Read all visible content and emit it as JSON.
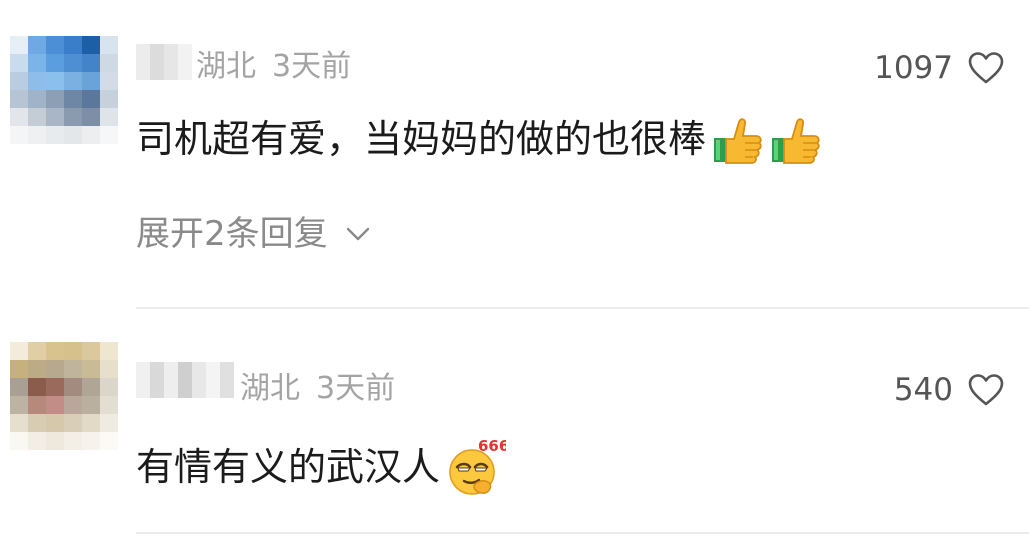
{
  "comments": [
    {
      "location": "湖北",
      "time": "3天前",
      "likes": "1097",
      "text": "司机超有爱，当妈妈的做的也很棒",
      "emojis": [
        "thumbs-up-icon",
        "thumbs-up-icon"
      ],
      "reply_toggle": "展开2条回复",
      "avatar_colors": [
        "#e6eef6",
        "#6fa9e3",
        "#4c8fd7",
        "#3a7dc9",
        "#1d5fa7",
        "#d7e3ef",
        "#c9dcee",
        "#7bb4e8",
        "#5b9ee0",
        "#4e8fd4",
        "#4483c8",
        "#cfd9e4",
        "#b9cde2",
        "#8fbde9",
        "#8cc0ec",
        "#7ab0e2",
        "#6aa3d8",
        "#d3dce6",
        "#b6c4d3",
        "#9fb3c9",
        "#8d9fb5",
        "#6e87a4",
        "#5b789c",
        "#c7d1dc",
        "#e2e6ea",
        "#c4ccd6",
        "#a9b6c5",
        "#8a9bb0",
        "#7d8fa6",
        "#dfe4ea",
        "#f5f5f5",
        "#eef0f2",
        "#e8ebee",
        "#e4e7ea",
        "#eceef0",
        "#f7f7f7"
      ],
      "name_colors": [
        "#ececec",
        "#dcdcdc",
        "#e6e6e6",
        "#f2f2f2"
      ]
    },
    {
      "location": "湖北",
      "time": "3天前",
      "likes": "540",
      "text": "有情有义的武汉人",
      "emojis": [
        "smirk-666-icon"
      ],
      "avatar_colors": [
        "#f3ecdc",
        "#e0cfa5",
        "#d8c38f",
        "#d6c08b",
        "#dbc89d",
        "#efe6d0",
        "#c6b17e",
        "#bcab86",
        "#b7a98e",
        "#c0b59c",
        "#c8bb95",
        "#e7dfcc",
        "#a99f92",
        "#8b5c4c",
        "#9a6a5c",
        "#a48b80",
        "#b0a596",
        "#dcd6ca",
        "#bdb3a2",
        "#b58a7c",
        "#c28d86",
        "#b8a79a",
        "#b9b0a0",
        "#e3ddd2",
        "#e7dfcd",
        "#d8ccb3",
        "#d5c8ab",
        "#d9cfb8",
        "#e2d9c6",
        "#f0ebe0",
        "#faf8f3",
        "#f2eee5",
        "#efe9dd",
        "#f3efe6",
        "#f6f3ed",
        "#fbfaf7"
      ],
      "name_colors": [
        "#f0f0f0",
        "#d9d9d9",
        "#eeeeee",
        "#cfcfcf",
        "#e8e8e8",
        "#f4f4f4",
        "#e0e0e0"
      ]
    }
  ],
  "colors": {
    "meta_text": "#a4a4a4",
    "body_text": "#1b1b1b",
    "reply_text": "#8a8a8a",
    "like_count": "#555555",
    "divider": "#ececec"
  }
}
